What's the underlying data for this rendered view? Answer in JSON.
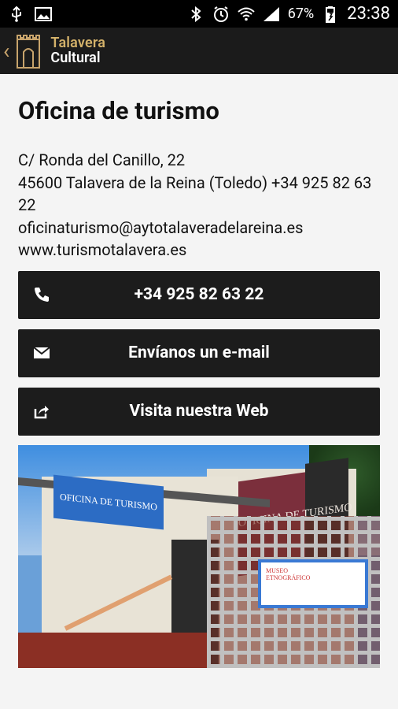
{
  "status_bar": {
    "time": "23:38",
    "battery": "67%",
    "icons": [
      "usb-icon",
      "image-icon",
      "bluetooth-icon",
      "alarm-icon",
      "wifi-icon",
      "signal-icon",
      "battery-icon"
    ]
  },
  "app_bar": {
    "brand_line1": "Talavera",
    "brand_line2": "Cultural",
    "accent_color": "#d4b26a"
  },
  "page": {
    "title": "Oficina de turismo",
    "address_line1": "C/ Ronda del Canillo, 22",
    "address_line2": "45600 Talavera de la Reina (Toledo) +34 925 82 63 22",
    "email": "oficinaturismo@aytotalaveradelareina.es",
    "web": "www.turismotalavera.es"
  },
  "buttons": {
    "phone_label": "+34 925 82 63 22",
    "email_label": "Envíanos un e-mail",
    "web_label": "Visita nuestra Web"
  },
  "photo": {
    "sign_text": "OFICINA DE TURISMO",
    "wall_text": "OFICINA DE TURISMO",
    "placard_text": "MUSEO ETNOGRÁFICO"
  }
}
